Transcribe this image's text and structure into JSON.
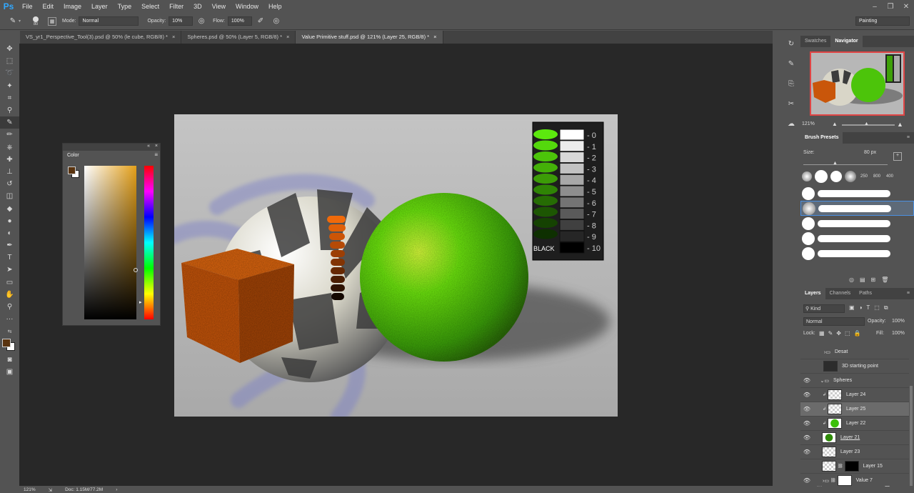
{
  "app": {
    "logo": "Ps"
  },
  "menu": [
    "File",
    "Edit",
    "Image",
    "Layer",
    "Type",
    "Select",
    "Filter",
    "3D",
    "View",
    "Window",
    "Help"
  ],
  "window_controls": [
    "–",
    "❐",
    "✕"
  ],
  "options": {
    "brush_size": "80",
    "mode_label": "Mode:",
    "mode_value": "Normal",
    "opacity_label": "Opacity:",
    "opacity_value": "10%",
    "flow_label": "Flow:",
    "flow_value": "100%",
    "workspace": "Painting"
  },
  "tabs": [
    {
      "label": "VS_yr1_Perspective_Tool(3).psd @ 50% (le cube, RGB/8) *"
    },
    {
      "label": "Spheres.psd @ 50% (Layer 5, RGB/8) *"
    },
    {
      "label": "Value Primitive stuff.psd @ 121% (Layer 25, RGB/8) *"
    }
  ],
  "status": {
    "zoom": "121%",
    "doc": "Doc: 1.15M/77.2M"
  },
  "color_panel": {
    "title": "Color"
  },
  "value_scale": {
    "numbers": [
      "0",
      "1",
      "2",
      "3",
      "4",
      "5",
      "6",
      "7",
      "8",
      "9",
      "10"
    ],
    "black_label": "BLACK",
    "greens": [
      "#5ce80e",
      "#54d80c",
      "#4cc40a",
      "#44b008",
      "#3c9c07",
      "#2f8405",
      "#266c04",
      "#1d5603",
      "#154202",
      "#0e3001"
    ],
    "grays": [
      "#ffffff",
      "#ececec",
      "#d8d8d8",
      "#c2c2c2",
      "#a8a8a8",
      "#8e8e8e",
      "#747474",
      "#5a5a5a",
      "#404040",
      "#262626",
      "#000000"
    ]
  },
  "right_panel": {
    "top_tabs": [
      "Swatches",
      "Navigator"
    ],
    "nav_zoom": "121%",
    "brush_presets_title": "Brush Presets",
    "size_label": "Size:",
    "size_value": "80 px",
    "preset_sizes": [
      "250",
      "800",
      "400"
    ],
    "layer_tabs": [
      "Layers",
      "Channels",
      "Paths"
    ],
    "kind_label": "Kind",
    "blend_mode": "Normal",
    "opacity_label": "Opacity:",
    "opacity_value": "100%",
    "lock_label": "Lock:",
    "fill_label": "Fill:",
    "fill_value": "100%",
    "layers": [
      {
        "name": "Desat",
        "visible": false,
        "group": true
      },
      {
        "name": "3D starting point",
        "visible": false
      },
      {
        "name": "Spheres",
        "visible": true,
        "group": true
      },
      {
        "name": "Layer 24",
        "visible": true
      },
      {
        "name": "Layer 25",
        "visible": true,
        "selected": true
      },
      {
        "name": "Layer 22",
        "visible": true
      },
      {
        "name": "Layer 21",
        "visible": true
      },
      {
        "name": "Layer 23",
        "visible": true
      },
      {
        "name": "Layer 15",
        "visible": false
      },
      {
        "name": "Value 7",
        "visible": true,
        "group": true
      }
    ]
  }
}
